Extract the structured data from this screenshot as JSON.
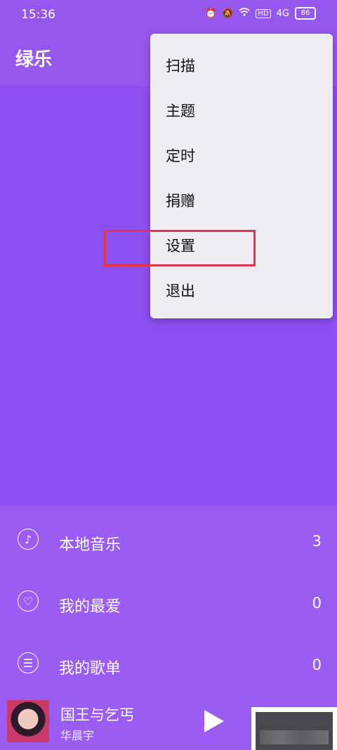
{
  "status_bar": {
    "time": "15:36",
    "icons": [
      "alarm-icon",
      "mute-icon",
      "wifi-icon",
      "hd-icon",
      "signal-4g-icon",
      "battery-icon"
    ],
    "hd_label": "HD",
    "network_label": "4G",
    "battery_level": "86"
  },
  "app_bar": {
    "title": "绿乐"
  },
  "menu": {
    "items": [
      {
        "label": "扫描"
      },
      {
        "label": "主题"
      },
      {
        "label": "定时"
      },
      {
        "label": "捐赠"
      },
      {
        "label": "设置"
      },
      {
        "label": "退出"
      }
    ],
    "highlight_color": "#e0364b"
  },
  "library": {
    "rows": [
      {
        "label": "本地音乐",
        "count": "3",
        "icon": "music-note-icon"
      },
      {
        "label": "我的最爱",
        "count": "0",
        "icon": "heart-icon"
      },
      {
        "label": "我的歌单",
        "count": "0",
        "icon": "list-icon"
      }
    ]
  },
  "now_playing": {
    "song": "国王与乞丐",
    "artist": "华晨宇"
  },
  "colors": {
    "primary": "#8c4ff0",
    "app_bar": "#9557ee",
    "menu_bg": "#efecf3"
  }
}
